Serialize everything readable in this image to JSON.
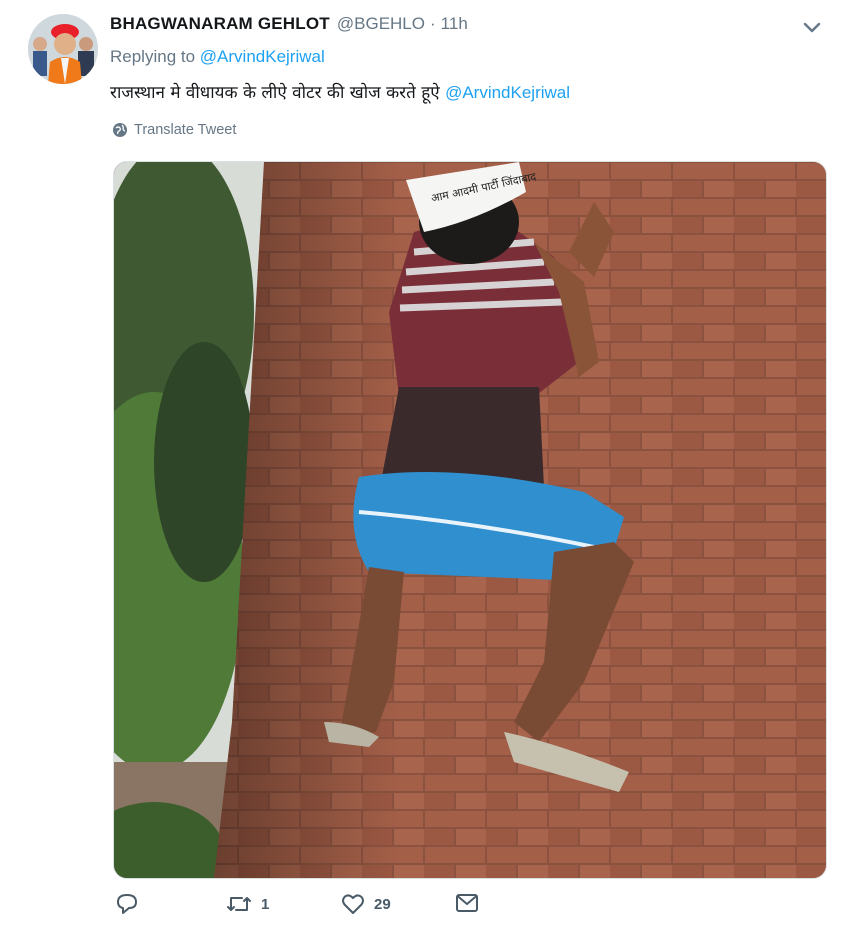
{
  "tweet": {
    "display_name": "BHAGWANARAM GEHLOT",
    "handle": "@BGEHLO",
    "separator": "·",
    "time": "11h",
    "replying_prefix": "Replying to",
    "replying_to": "@ArvindKejriwal",
    "text_body": "राजस्थान मे वीधायक के लीऐ वोटर की खोज करते हूऐ",
    "text_mention": "@ArvindKejriwal",
    "translate_label": "Translate Tweet",
    "media_cap_text": "आम आदमी पार्टी जिंदाबाद",
    "actions": {
      "reply_count": "",
      "retweet_count": "1",
      "like_count": "29"
    }
  },
  "colors": {
    "link": "#1da1f2",
    "secondary_text": "#657786",
    "primary_text": "#14171a",
    "brick": "#9a5a45"
  },
  "icons": [
    "chevron-down-icon",
    "globe-icon",
    "reply-icon",
    "retweet-icon",
    "like-icon",
    "message-icon"
  ]
}
